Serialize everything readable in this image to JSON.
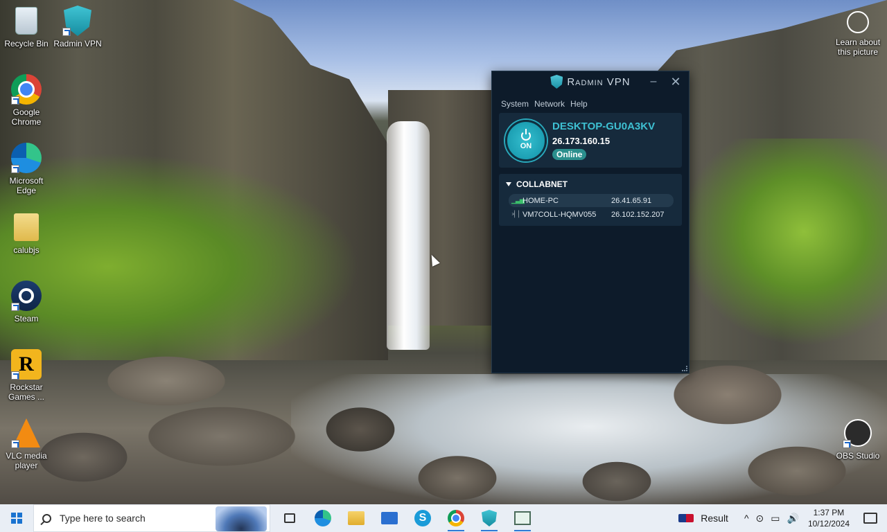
{
  "desktop": {
    "icons": [
      {
        "label": "Recycle Bin",
        "icon": "recycle-bin-icon"
      },
      {
        "label": "Radmin VPN",
        "icon": "radmin-vpn-icon"
      },
      {
        "label": "Google Chrome",
        "icon": "chrome-icon"
      },
      {
        "label": "Microsoft Edge",
        "icon": "edge-icon"
      },
      {
        "label": "calubjs",
        "icon": "folder-icon"
      },
      {
        "label": "Steam",
        "icon": "steam-icon"
      },
      {
        "label": "Rockstar Games ...",
        "icon": "rockstar-icon"
      },
      {
        "label": "VLC media player",
        "icon": "vlc-icon"
      },
      {
        "label": "OBS Studio",
        "icon": "obs-icon"
      }
    ],
    "learn": {
      "label": "Learn about this picture"
    }
  },
  "vpn": {
    "title": "Radmin VPN",
    "menu": [
      "System",
      "Network",
      "Help"
    ],
    "self": {
      "power_label": "ON",
      "name": "DESKTOP-GU0A3KV",
      "ip": "26.173.160.15",
      "status": "Online"
    },
    "network": {
      "name": "COLLABNET",
      "peers": [
        {
          "name": "HOME-PC",
          "ip": "26.41.65.91",
          "online": true
        },
        {
          "name": "VM7COLL-HQMV055",
          "ip": "26.102.152.207",
          "online": false
        }
      ]
    },
    "accent_color": "#3ec0d2"
  },
  "taskbar": {
    "search_placeholder": "Type here to search",
    "pinned": [
      "task-view-icon",
      "edge-icon",
      "file-explorer-icon",
      "mail-icon",
      "skype-icon",
      "chrome-icon",
      "radmin-vpn-icon",
      "app-icon"
    ],
    "news": "Result",
    "tray_glyphs": [
      "^",
      "⊙",
      "▭",
      "🔊"
    ],
    "time": "1:37 PM",
    "date": "10/12/2024"
  }
}
